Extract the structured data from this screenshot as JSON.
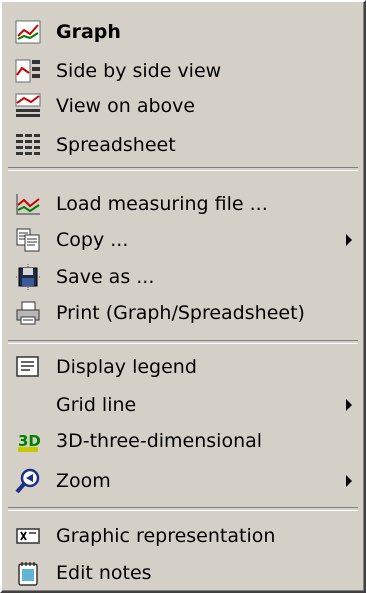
{
  "menu": {
    "items": [
      {
        "label": "Graph",
        "icon": "graph-icon"
      },
      {
        "label": "Side by side view",
        "icon": "side-by-side-icon"
      },
      {
        "label": "View on above",
        "icon": "view-above-icon"
      },
      {
        "label": "Spreadsheet",
        "icon": "spreadsheet-icon"
      },
      {
        "label": "Load measuring file ...",
        "icon": "load-file-icon"
      },
      {
        "label": "Copy ...",
        "icon": "copy-icon"
      },
      {
        "label": "Save as ...",
        "icon": "save-icon"
      },
      {
        "label": "Print (Graph/Spreadsheet)",
        "icon": "print-icon"
      },
      {
        "label": "Display legend",
        "icon": "legend-icon"
      },
      {
        "label": "Grid line",
        "icon": ""
      },
      {
        "label": "3D-three-dimensional",
        "icon": "3d-icon"
      },
      {
        "label": "Zoom",
        "icon": "zoom-icon"
      },
      {
        "label": "Graphic representation",
        "icon": "graphic-representation-icon"
      },
      {
        "label": "Edit notes",
        "icon": "notes-icon"
      }
    ]
  },
  "colors": {
    "menu_bg": "#d4d0c8",
    "accent_red": "#cc0000",
    "accent_green": "#008000"
  }
}
